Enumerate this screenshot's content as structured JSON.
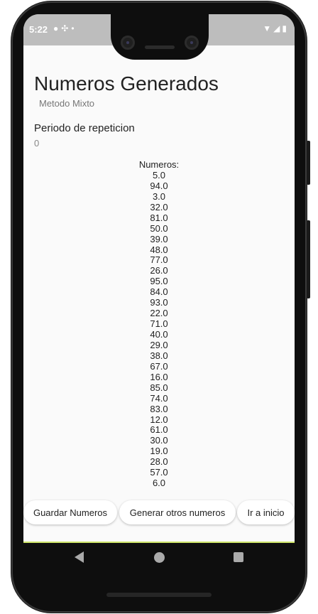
{
  "status_bar": {
    "time": "5:22",
    "notification_icons": [
      "chat-bubble-icon",
      "sparkle-icon",
      "dot-icon"
    ],
    "right_icons": [
      "wifi-icon",
      "signal-icon",
      "battery-icon"
    ]
  },
  "header": {
    "title": "Numeros Generados",
    "subtitle": "Metodo Mixto"
  },
  "period": {
    "label": "Periodo de repeticion",
    "value": "0"
  },
  "numbers": {
    "label": "Numeros:",
    "values": [
      "5.0",
      "94.0",
      "3.0",
      "32.0",
      "81.0",
      "50.0",
      "39.0",
      "48.0",
      "77.0",
      "26.0",
      "95.0",
      "84.0",
      "93.0",
      "22.0",
      "71.0",
      "40.0",
      "29.0",
      "38.0",
      "67.0",
      "16.0",
      "85.0",
      "74.0",
      "83.0",
      "12.0",
      "61.0",
      "30.0",
      "19.0",
      "28.0",
      "57.0",
      "6.0"
    ]
  },
  "actions": {
    "save_label": "Guardar Numeros",
    "generate_label": "Generar otros numeros",
    "home_label": "Ir a inicio"
  },
  "nav": [
    "back-icon",
    "home-icon",
    "recents-icon"
  ],
  "colors": {
    "status_bar_bg": "#bdbdbd",
    "screen_bg": "#fafafa",
    "button_bg": "#ffffff",
    "nav_bar_bg": "#0e0e0e"
  }
}
